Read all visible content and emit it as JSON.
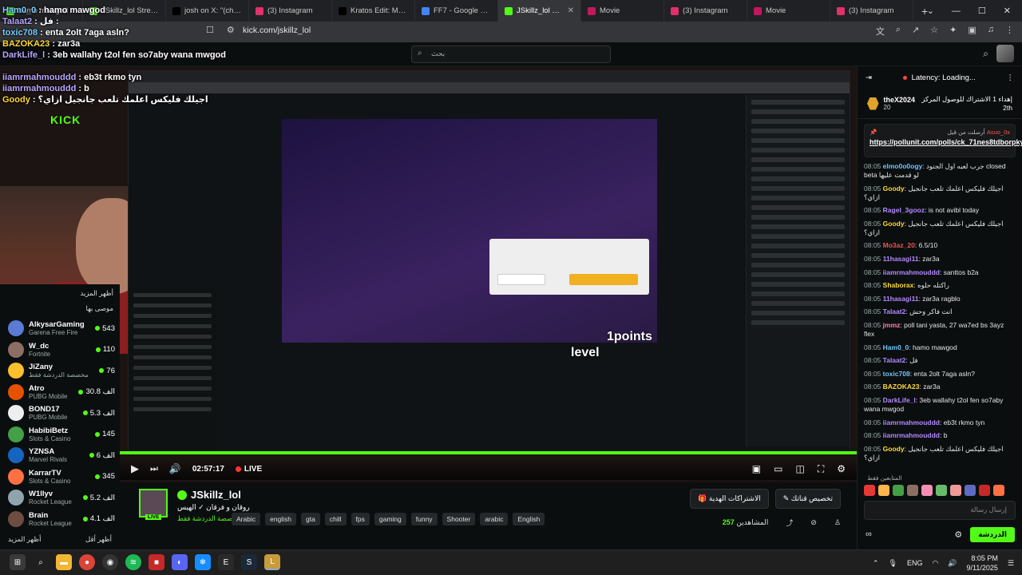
{
  "browser": {
    "tabs": [
      {
        "title": "hamo mawgod",
        "favicon_color": "#53fc18",
        "active": false
      },
      {
        "title": "JSkillz_lol Stream - V",
        "favicon_color": "#53fc18",
        "active": false
      },
      {
        "title": "josh on X: \"(charlie",
        "favicon_color": "#000000",
        "active": false
      },
      {
        "title": "(3) Instagram",
        "favicon_color": "#e1306c",
        "active": false
      },
      {
        "title": "Kratos Edit: Montag",
        "favicon_color": "#010101",
        "active": false
      },
      {
        "title": "FF7 - Google Search",
        "favicon_color": "#4285f4",
        "active": false
      },
      {
        "title": "JSkillz_lol Strea",
        "favicon_color": "#53fc18",
        "active": true
      },
      {
        "title": "Movie",
        "favicon_color": "#c2185b",
        "active": false
      },
      {
        "title": "(3) Instagram",
        "favicon_color": "#e1306c",
        "active": false
      },
      {
        "title": "Movie",
        "favicon_color": "#c2185b",
        "active": false
      },
      {
        "title": "(3) Instagram",
        "favicon_color": "#e1306c",
        "active": false
      }
    ],
    "new_tab": "+",
    "url": "kick.com/jskillz_lol"
  },
  "header": {
    "search_placeholder": "بحث"
  },
  "overlay_chat": [
    {
      "user": "Ham0_0",
      "text": "hamo mawgod",
      "cls": "c2"
    },
    {
      "user": "Talaat2",
      "text": "فل :",
      "cls": ""
    },
    {
      "user": "toxic708",
      "text": "enta 2olt 7aga asln?",
      "cls": "c2"
    },
    {
      "user": "BAZOKA23",
      "text": "zar3a",
      "cls": "c3"
    },
    {
      "user": "DarkLife_l",
      "text": "3eb wallahy t2ol fen so7aby wana mwgod",
      "cls": ""
    },
    {
      "user": "",
      "text": "",
      "cls": ""
    },
    {
      "user": "iiamrmahmouddd",
      "text": "eb3t rkmo tyn",
      "cls": ""
    },
    {
      "user": "iiamrmahmouddd",
      "text": "b",
      "cls": ""
    },
    {
      "user": "Goody",
      "text": "اجيلك فليكس اعلمك تلعب جانجيل ازاي؟",
      "cls": "c3"
    }
  ],
  "stream_overlay": {
    "kick_text": "KICK",
    "points_text": "1points",
    "level_text": "level"
  },
  "recommended": {
    "show_more": "أظهر المزيد",
    "section": "موصى بها",
    "items": [
      {
        "name": "AlkysarGaming",
        "category": "Garena Free Fire",
        "viewers": "543",
        "color": "#5b7bd5"
      },
      {
        "name": "W_dc",
        "category": "Fortnite",
        "viewers": "110",
        "color": "#8d6e63"
      },
      {
        "name": "JiZany",
        "category": "مخصصة الدردشة فقط",
        "viewers": "76",
        "color": "#fbc02d"
      },
      {
        "name": "Atro",
        "category": "PUBG Mobile",
        "viewers": "30.8 الف",
        "color": "#e65100"
      },
      {
        "name": "BOND17",
        "category": "PUBG Mobile",
        "viewers": "5.3 الف",
        "color": "#eeeeee"
      },
      {
        "name": "HabibiBetz",
        "category": "Slots & Casino",
        "viewers": "145",
        "color": "#43a047"
      },
      {
        "name": "YZNSA",
        "category": "Marvel Rivals",
        "viewers": "6 الف",
        "color": "#1565c0"
      },
      {
        "name": "KarrarTV",
        "category": "Slots & Casino",
        "viewers": "345",
        "color": "#ff7043"
      },
      {
        "name": "W1llyv",
        "category": "Rocket League",
        "viewers": "5.2 الف",
        "color": "#90a4ae"
      },
      {
        "name": "Brain",
        "category": "Rocket League",
        "viewers": "4.1 الف",
        "color": "#6d4c41"
      }
    ],
    "footer_left": "أظهر المزيد",
    "footer_right": "أظهر أقل"
  },
  "player": {
    "time": "02:57:17",
    "live": "LIVE"
  },
  "streamer": {
    "name": "JSkillz_lol",
    "title": "روقان و فرقان ✓ الهيس",
    "category": "مخصصة الدردشة فقط",
    "live_badge": "LIVE",
    "tags": [
      "Arabic",
      "english",
      "gta",
      "chill",
      "fps",
      "gaming",
      "funny",
      "Shooter",
      "arabic",
      "English"
    ],
    "btn_subs": "الاشتراكات الهدية",
    "btn_custom": "تخصيص قناتك",
    "viewers_label": "المشاهدين",
    "viewers": "257"
  },
  "chat": {
    "latency": "Latency: Loading...",
    "leader": {
      "name": "theX2024",
      "count": "20",
      "rank_text": "إهداء 1 الاشتراك للوصول المركز 2th"
    },
    "pinned": {
      "label": "أرسلت من قبل",
      "by": "Asuo_0x",
      "link": "https://pollunit.com/polls/ck_71nes8tdborpkyjgmha"
    },
    "messages": [
      {
        "time": "08:05",
        "user": "elmo0o0ogy",
        "text": "جرب لعبه اول الجنود closed beta لو قدمت عليها",
        "color": "#6ec6ff"
      },
      {
        "time": "08:05",
        "user": "Goody",
        "text": "اجيلك فليكس اعلمك تلعب جانجيل ازاي؟",
        "color": "#fdd835"
      },
      {
        "time": "08:05",
        "user": "Ragel_3gooz",
        "text": "is not avibl today",
        "color": "#b388ff"
      },
      {
        "time": "08:05",
        "user": "Goody",
        "text": "اجيلك فليكس اعلمك تلعب جانجيل ازاي؟",
        "color": "#fdd835"
      },
      {
        "time": "08:05",
        "user": "Mo3az_20",
        "text": "6.5/10",
        "color": "#ef5350"
      },
      {
        "time": "08:05",
        "user": "11hasagi11",
        "text": "zar3a",
        "color": "#b388ff"
      },
      {
        "time": "08:05",
        "user": "iiamrmahmouddd",
        "text": "santtos b2a",
        "color": "#b388ff"
      },
      {
        "time": "08:05",
        "user": "Shaborax",
        "text": "راكتله حلوه",
        "color": "#fdd835"
      },
      {
        "time": "08:05",
        "user": "11hasagi11",
        "text": "zar3a ragblo",
        "color": "#b388ff"
      },
      {
        "time": "08:05",
        "user": "Talaat2",
        "text": "انت فاكر وحش",
        "color": "#b388ff"
      },
      {
        "time": "08:05",
        "user": "jmmz",
        "text": "poll tani yasta, 27 wa7ed bs 3ayz flex",
        "color": "#ff80ab"
      },
      {
        "time": "08:05",
        "user": "Ham0_0",
        "text": "hamo mawgod",
        "color": "#6ec6ff"
      },
      {
        "time": "08:05",
        "user": "Talaat2",
        "text": "فل",
        "color": "#b388ff"
      },
      {
        "time": "08:05",
        "user": "toxic708",
        "text": "enta 2olt 7aga asln?",
        "color": "#6ec6ff"
      },
      {
        "time": "08:05",
        "user": "BAZOKA23",
        "text": "zar3a",
        "color": "#fdd835"
      },
      {
        "time": "08:05",
        "user": "DarkLife_l",
        "text": "3eb wallahy t2ol fen so7aby wana mwgod",
        "color": "#b388ff"
      },
      {
        "time": "08:05",
        "user": "iiamrmahmouddd",
        "text": "eb3t rkmo tyn",
        "color": "#b388ff"
      },
      {
        "time": "08:05",
        "user": "iiamrmahmouddd",
        "text": "b",
        "color": "#b388ff"
      },
      {
        "time": "08:05",
        "user": "Goody",
        "text": "اجيلك فليكس اعلمك تلعب جانجيل ازاي؟",
        "color": "#fdd835"
      }
    ],
    "subscribers_label": "المتابعين فقط",
    "input_placeholder": "إرسال رسالة",
    "send_label": "الدردشة"
  },
  "taskbar": {
    "lang": "ENG",
    "time": "8:05 PM",
    "date": "9/11/2025"
  }
}
